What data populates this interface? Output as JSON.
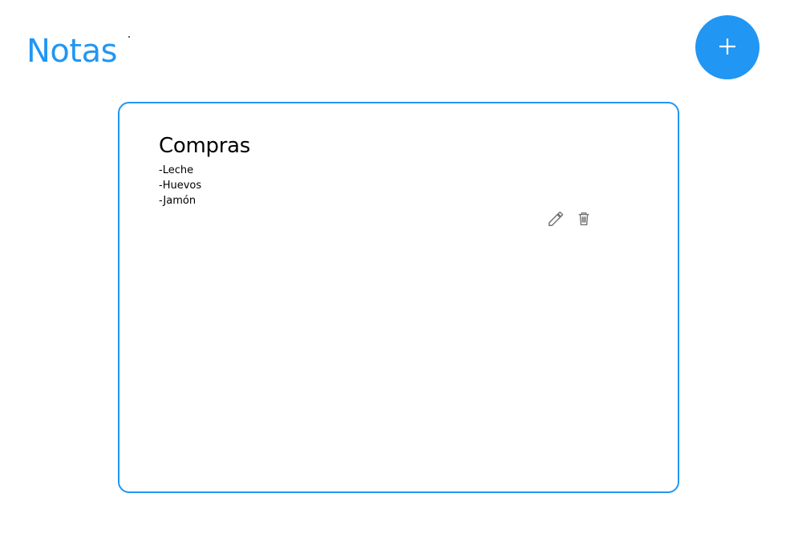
{
  "header": {
    "title": "Notas",
    "add_button_icon": "plus-icon"
  },
  "notes": [
    {
      "title": "Compras",
      "lines": [
        "-Leche",
        "-Huevos",
        "-Jamón"
      ],
      "edit_icon": "pencil-icon",
      "delete_icon": "trash-icon"
    }
  ],
  "colors": {
    "accent": "#2196f3",
    "icon": "#757575",
    "text": "#000000"
  }
}
